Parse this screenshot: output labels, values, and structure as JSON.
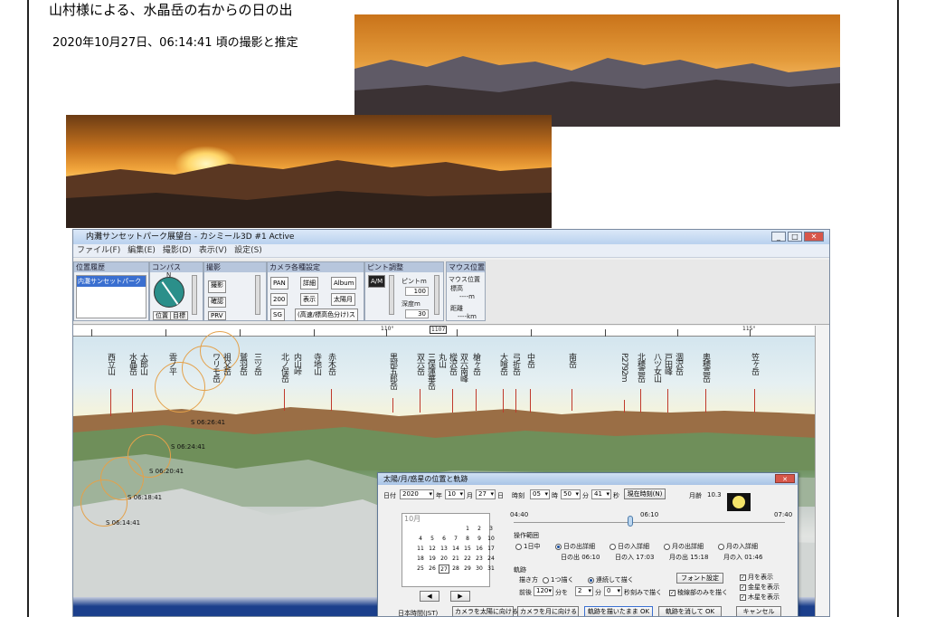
{
  "caption": {
    "title": "山村様による、水晶岳の右からの日の出",
    "subtitle": "2020年10月27日、06:14:41 頃の撮影と推定"
  },
  "app": {
    "window_title": "内灘サンセットパーク展望台 - カシミール3D #1 Active",
    "menu": [
      "ファイル(F)",
      "編集(E)",
      "撮影(D)",
      "表示(V)",
      "設定(S)"
    ],
    "panels": {
      "history": {
        "title": "位置履歴",
        "item": "内灘サンセットパーク"
      },
      "compass": {
        "title": "コンパス",
        "north": "N",
        "btn_position": "位置",
        "btn_target": "目標",
        "vlabel": "対地高度"
      },
      "shoot": {
        "title": "撮影",
        "btn_shoot": "撮影",
        "btn_confirm": "確認",
        "btn_prv": "PRV",
        "vlabel": "描画範囲km"
      },
      "camera": {
        "title": "カメラ各種設定",
        "btn_pan": "PAN",
        "btn_detail": "詳細",
        "btn_album": "Album",
        "btn_200": "200",
        "btn_display": "表示",
        "btn_sun": "太陽月",
        "btn_sg": "SG",
        "btn_fast": "(高速/標高色分け)ス"
      },
      "focus": {
        "title": "ピント調整",
        "btn_am": "A/M",
        "focus_label": "ピントm",
        "focus_value": "100",
        "depth_label": "深度m",
        "depth_value": "30"
      },
      "mouse": {
        "title": "マウス位置",
        "pos_label": "マウス位置",
        "elev_label": "標高",
        "elev_unit": "----m",
        "dist_label": "距離",
        "dist_unit": "----km"
      }
    },
    "ruler": {
      "labels": [
        "110°",
        "1107",
        "115°"
      ]
    },
    "mountains": [
      "西立山",
      "水晶岳",
      "太郎山",
      "雲ノ平",
      "ワリモ岳",
      "祖父岳",
      "鷲羽岳",
      "三ツ岳",
      "北ノ俣岳",
      "内山峠",
      "寺地山",
      "赤木岳",
      "黒部五郎岳",
      "双六岳",
      "三俣蓮華岳",
      "丸山",
      "樅沢岳",
      "双六南峰",
      "中岳",
      "槍ヶ岳",
      "大喰岳",
      "弓折岳",
      "南岳",
      "P.2792m",
      "北穂高岳",
      "八ツ女山",
      "戸田峰",
      "涸沢岳",
      "奥穂高岳",
      "笠ヶ岳"
    ],
    "sun_labels": [
      "S 06:26:41",
      "S 06:24:41",
      "S 06:20:41",
      "S 06:18:41",
      "S 06:14:41"
    ],
    "dialog": {
      "title": "太陽/月/惑星の位置と軌跡",
      "date_label": "日付",
      "year": "2020",
      "year_unit": "年",
      "month": "10",
      "month_unit": "月",
      "day": "27",
      "day_unit": "日",
      "time_label": "時刻",
      "hour": "05",
      "hour_unit": "時",
      "minute": "50",
      "minute_unit": "分",
      "second": "41",
      "second_unit": "秒",
      "now_button": "現在時刻(N)",
      "moon_age_label": "月齢",
      "moon_age": "10.3",
      "calendar_month": "10月",
      "calendar_days": [
        "",
        "",
        "",
        "",
        "1",
        "2",
        "3",
        "4",
        "5",
        "6",
        "7",
        "8",
        "9",
        "10",
        "11",
        "12",
        "13",
        "14",
        "15",
        "16",
        "17",
        "18",
        "19",
        "20",
        "21",
        "22",
        "23",
        "24",
        "25",
        "26",
        "27",
        "28",
        "29",
        "30",
        "31"
      ],
      "time_start": "04:40",
      "time_mid": "06:10",
      "time_end": "07:40",
      "range_label": "操作範囲",
      "range_options": [
        "1日中",
        "日の出詳細",
        "日の入詳細",
        "月の出詳細",
        "月の入詳細"
      ],
      "sunrise": "日の出 06:10",
      "sunset": "日の入 17:03",
      "moonrise": "月の出 15:18",
      "moonset": "月の入 01:46",
      "track_label": "軌跡",
      "draw_label": "描き方",
      "draw_one": "1つ描く",
      "draw_continuous": "連続して描く",
      "font_button": "フォント設定",
      "before_label": "前後",
      "before_value": "120",
      "before_unit": "分を",
      "step_min": "2",
      "step_min_unit": "分",
      "step_sec": "0",
      "step_sec_unit": "秒刻みで描く",
      "detail_only": "稜線部のみを描く",
      "show_moon": "月を表示",
      "show_venus": "金星を表示",
      "show_jupiter": "木星を表示",
      "jst_label": "日本時間(JST)",
      "btn_camera_sun": "カメラを太陽に向ける",
      "btn_camera_moon": "カメラを月に向ける",
      "btn_track_ok": "軌跡を描いたまま OK",
      "btn_track_clear": "軌跡を消して OK",
      "btn_cancel": "キャンセル"
    }
  }
}
